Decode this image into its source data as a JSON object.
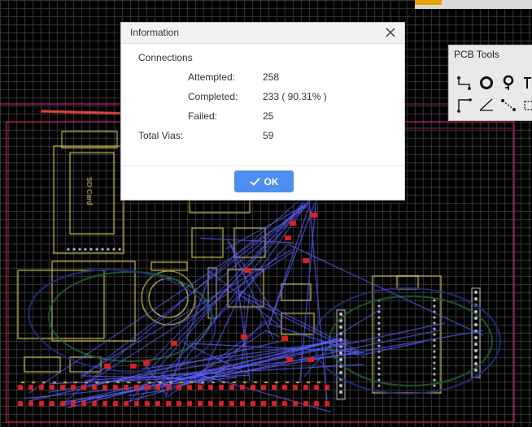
{
  "dialog": {
    "title": "Information",
    "close_icon": "close-icon",
    "section": "Connections",
    "rows": {
      "attempted": {
        "label": "Attempted:",
        "value": "258"
      },
      "completed": {
        "label": "Completed:",
        "value": "233 ( 90.31% )"
      },
      "failed": {
        "label": "Failed:",
        "value": "25"
      },
      "vias": {
        "label": "Total Vias:",
        "value": "59"
      }
    },
    "ok_label": "OK",
    "ok_icon": "checkmark-icon",
    "accent_color": "#4d8ef0"
  },
  "pcb_tools": {
    "title": "PCB Tools",
    "tools": [
      "track-icon",
      "pad-icon",
      "via-icon",
      "text-icon",
      "line-icon",
      "arc-icon",
      "connect-icon",
      "rectangle-icon"
    ]
  },
  "board": {
    "silkscreen_text": [
      "SD Card"
    ],
    "colors": {
      "grid": "#3a3a3a",
      "board_outline": "#b01d6a",
      "silkscreen": "#d4c85c",
      "ratsnest": "#5b63ff",
      "pads": "#e02020",
      "annotation_arrow": "#e8463d"
    }
  }
}
